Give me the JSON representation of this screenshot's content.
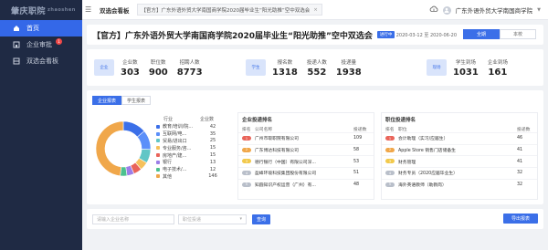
{
  "sidebar": {
    "logo": "肇庆职院",
    "logo_sub": "zhaoshen",
    "items": [
      {
        "label": "首页",
        "active": true
      },
      {
        "label": "企业审批",
        "badge": "1"
      },
      {
        "label": "双选会看板"
      }
    ]
  },
  "topbar": {
    "crumb": "双选会看板",
    "tab_label": "【官方】广东外语外贸大学南国商学院2020届毕业生“阳光助推”空中双选会",
    "tab_close": "×",
    "user": "广东外语外贸大学南国商学院"
  },
  "header": {
    "title": "【官方】广东外语外贸大学南国商学院2020届毕业生“阳光助推”空中双选会",
    "status": "进行中",
    "date": "2020-03-12 至 2020-06-20",
    "seg": [
      "全期",
      "本校"
    ]
  },
  "stats": {
    "groups": [
      {
        "icon_label": "企业",
        "items": [
          {
            "label": "企业数",
            "value": "303"
          },
          {
            "label": "职位数",
            "value": "900"
          },
          {
            "label": "招聘人数",
            "value": "8773"
          }
        ]
      },
      {
        "icon_label": "学生",
        "items": [
          {
            "label": "报名数",
            "value": "1318"
          },
          {
            "label": "投递人数",
            "value": "552"
          },
          {
            "label": "投递量",
            "value": "1938"
          }
        ]
      },
      {
        "icon_label": "现场",
        "items": [
          {
            "label": "学生到场",
            "value": "1031"
          },
          {
            "label": "企业到场",
            "value": "161"
          }
        ]
      }
    ]
  },
  "data_tabs": [
    "企业报表",
    "学生报表"
  ],
  "industry": {
    "col_industry": "行业",
    "col_count": "企业数",
    "rows": [
      {
        "name": "教育/培训/院...",
        "count": "42",
        "color": "#3b6fe8"
      },
      {
        "name": "互联网/电...",
        "count": "35",
        "color": "#5b8ff9"
      },
      {
        "name": "贸易/进出口",
        "count": "25",
        "color": "#61c6c6"
      },
      {
        "name": "专业服务/咨...",
        "count": "15",
        "color": "#f6c15c"
      },
      {
        "name": "房地产/建...",
        "count": "15",
        "color": "#e9645a"
      },
      {
        "name": "银行",
        "count": "13",
        "color": "#9b7ee8"
      },
      {
        "name": "电子技术/...",
        "count": "12",
        "color": "#4cc18f"
      },
      {
        "name": "其他",
        "count": "146",
        "color": "#f0a74a"
      }
    ]
  },
  "company_panel": {
    "title": "企业投递排名",
    "cols": [
      "排名",
      "公司名称",
      "投递数"
    ],
    "rows": [
      {
        "rank": "1",
        "name": "广州市取职院有限公司",
        "count": "109"
      },
      {
        "rank": "2",
        "name": "广东博达科技有限公司",
        "count": "58"
      },
      {
        "rank": "3",
        "name": "德行银行（中国）有限公司深...",
        "count": "53"
      },
      {
        "rank": "4",
        "name": "盈峰环境科技集团股份有限公司",
        "count": "51"
      },
      {
        "rank": "5",
        "name": "知圆知识产权运营（广州）有...",
        "count": "48"
      }
    ]
  },
  "job_panel": {
    "title": "职位投递排名",
    "cols": [
      "排名",
      "职位",
      "投递数"
    ],
    "rows": [
      {
        "rank": "1",
        "name": "会计助理（实习/应届生）",
        "count": "46"
      },
      {
        "rank": "2",
        "name": "Apple Store 销售门店储备生",
        "count": "41"
      },
      {
        "rank": "3",
        "name": "财务管理",
        "count": "41"
      },
      {
        "rank": "4",
        "name": "财务专员（2020应届毕业生）",
        "count": "32"
      },
      {
        "rank": "5",
        "name": "海外英语教师（助教岗）",
        "count": "32"
      }
    ]
  },
  "search": {
    "company_placeholder": "请输入企业名称",
    "job_placeholder": "职位投递",
    "search_btn": "查询",
    "export_btn": "导出报表"
  },
  "chart_data": {
    "type": "pie",
    "categories": [
      "教育/培训/院...",
      "互联网/电...",
      "贸易/进出口",
      "专业服务/咨...",
      "房地产/建...",
      "银行",
      "电子技术/...",
      "其他"
    ],
    "values": [
      42,
      35,
      25,
      15,
      15,
      13,
      12,
      146
    ]
  }
}
